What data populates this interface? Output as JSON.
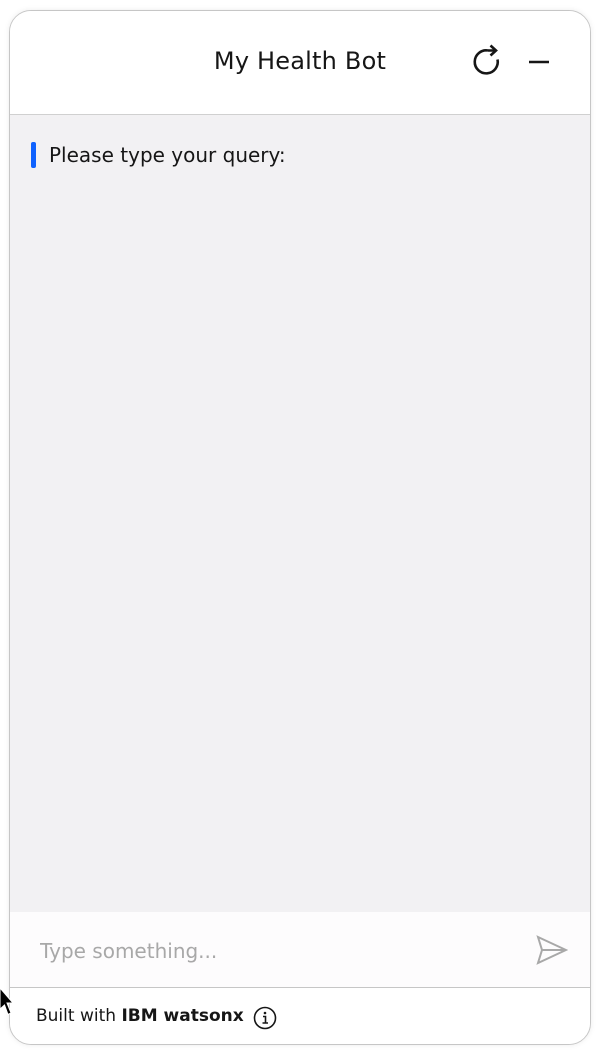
{
  "header": {
    "title": "My Health Bot"
  },
  "icons": {
    "restart": "restart-icon",
    "minimize": "minimize-icon",
    "send": "send-icon",
    "info": "info-icon"
  },
  "messages": [
    {
      "text": "Please type your query:"
    }
  ],
  "input": {
    "placeholder": "Type something...",
    "value": ""
  },
  "footer": {
    "prefix": "Built with",
    "brand": "IBM watsonx"
  },
  "colors": {
    "accent": "#0f62fe",
    "chat_background": "#f2f1f3",
    "text": "#161616",
    "placeholder": "#a8a8a8"
  }
}
